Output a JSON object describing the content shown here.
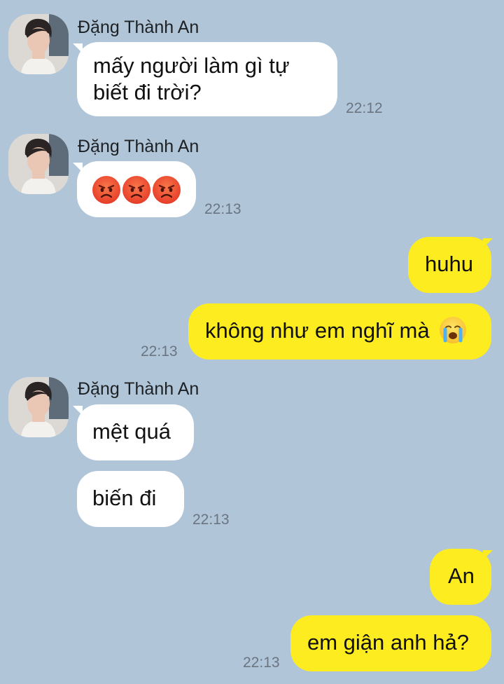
{
  "messages": [
    {
      "sender": "Đặng Thành An",
      "text_lines": [
        "mấy người làm gì tự",
        "biết đi trời?"
      ],
      "time": "22:12"
    },
    {
      "sender": "Đặng Thành An",
      "emojis": [
        "angry-face-emoji",
        "angry-face-emoji",
        "angry-face-emoji"
      ],
      "time": "22:13"
    },
    {
      "outgoing": true,
      "text": "huhu"
    },
    {
      "outgoing": true,
      "text": "không như em nghĩ mà",
      "emoji": "crying-face-emoji",
      "time": "22:13"
    },
    {
      "sender": "Đặng Thành An",
      "text": "mệt quá"
    },
    {
      "text": "biến đi",
      "time": "22:13"
    },
    {
      "outgoing": true,
      "text": "An"
    },
    {
      "outgoing": true,
      "text": "em giận anh hả?",
      "time": "22:13"
    }
  ],
  "colors": {
    "background": "#b1c5d9",
    "incoming_bubble": "#ffffff",
    "outgoing_bubble": "#fdec1f",
    "timestamp": "#6a7581"
  }
}
